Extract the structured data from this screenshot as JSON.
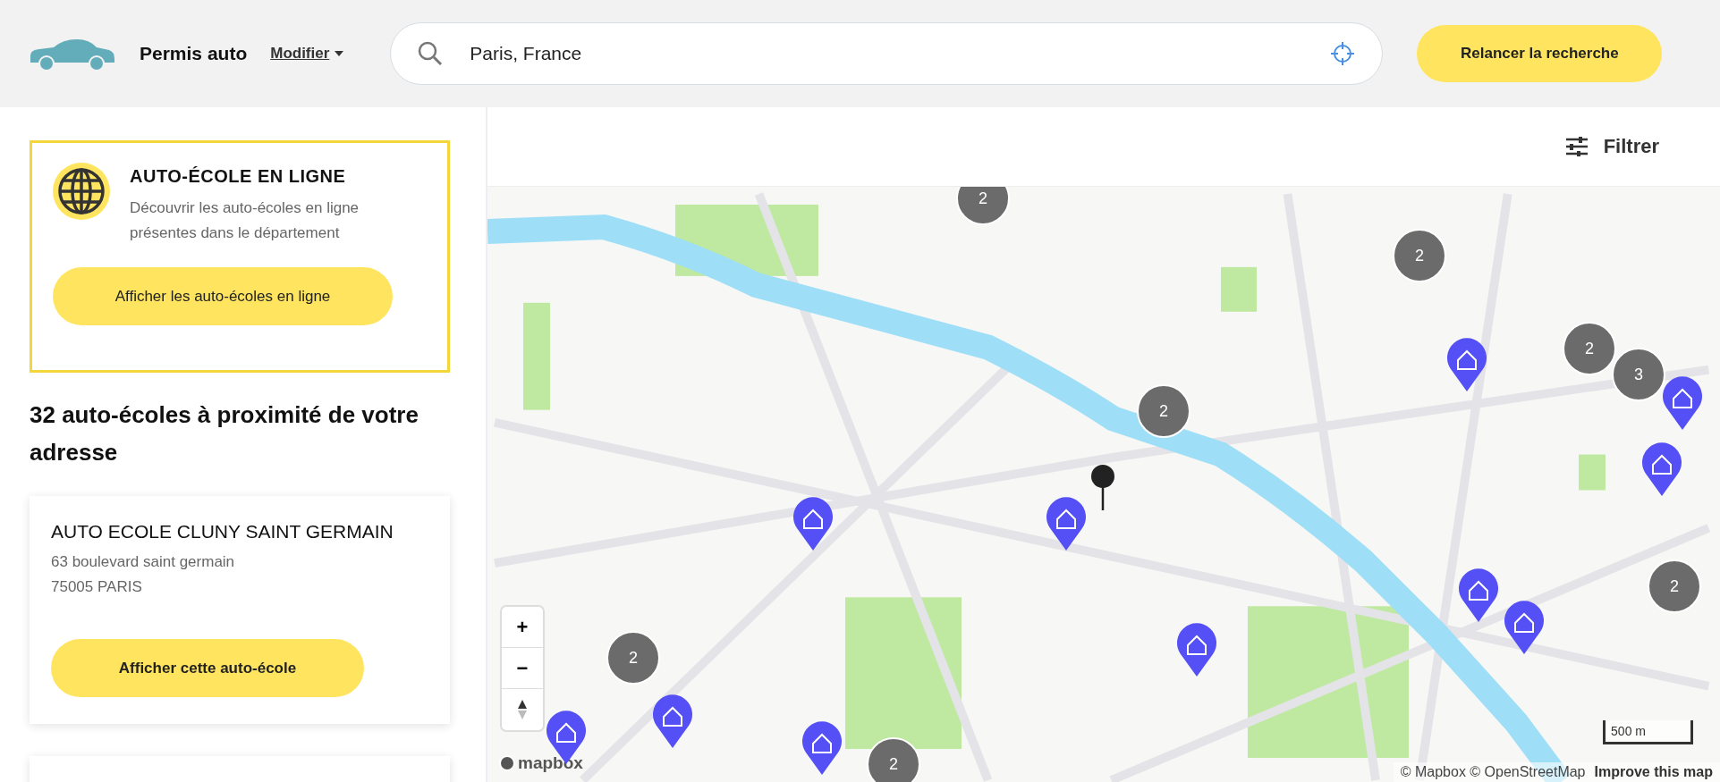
{
  "header": {
    "title": "Permis auto",
    "modify_link": "Modifier",
    "search": {
      "value": "Paris, France"
    },
    "relaunch_button": "Relancer la recherche"
  },
  "online_card": {
    "title": "AUTO-ÉCOLE EN LIGNE",
    "description": "Découvrir les auto-écoles en ligne présentes dans le département",
    "button": "Afficher les auto-écoles en ligne"
  },
  "results_heading": "32 auto-écoles à proximité de votre adresse",
  "schools": [
    {
      "name": "AUTO ECOLE CLUNY SAINT GERMAIN",
      "address": "63 boulevard saint germain",
      "city": "75005 PARIS",
      "button": "Afficher cette auto-école"
    }
  ],
  "map": {
    "filter_button": "Filtrer",
    "clusters": [
      "2",
      "2",
      "2",
      "3",
      "2",
      "2",
      "2",
      "2"
    ],
    "zoom_in": "+",
    "zoom_out": "−",
    "scale": "500 m",
    "attribution": "© Mapbox © OpenStreetMap",
    "improve_link": "Improve this map",
    "logo": "mapbox"
  }
}
